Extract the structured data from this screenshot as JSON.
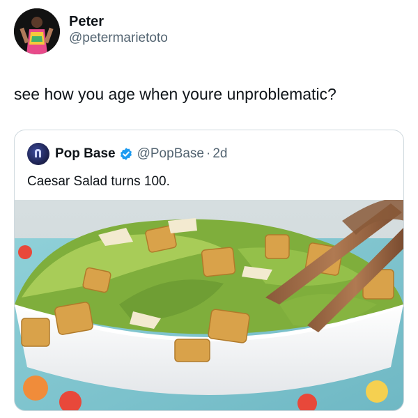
{
  "tweet": {
    "author_name": "Peter",
    "author_handle": "@petermarietoto",
    "text": "see how you age when youre unproblematic?"
  },
  "quote": {
    "author_name": "Pop Base",
    "author_handle": "@PopBase",
    "separator": "·",
    "time": "2d",
    "text": "Caesar Salad turns 100.",
    "verified": true
  },
  "media": {
    "description_icon": "salad-photo"
  },
  "colors": {
    "text": "#0f1419",
    "secondary": "#536471",
    "border": "#cfd9de",
    "verified": "#1d9bf0"
  }
}
